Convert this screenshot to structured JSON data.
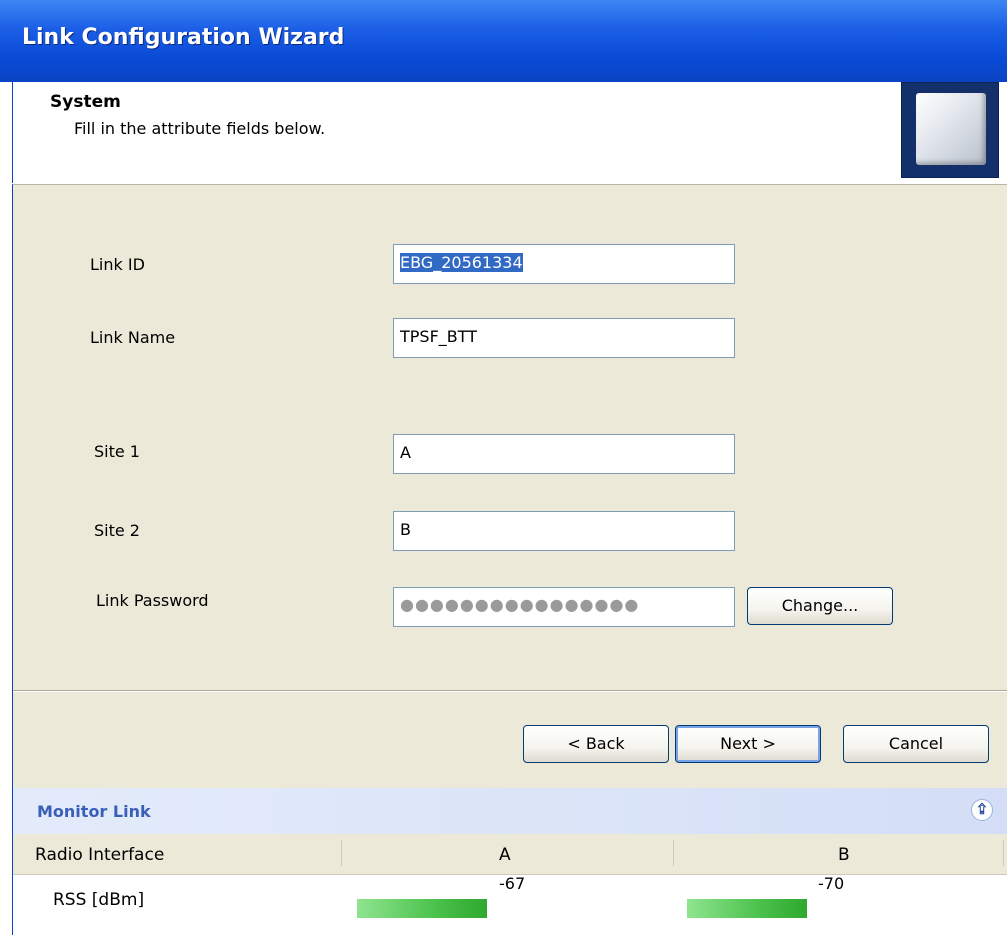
{
  "window": {
    "title": "Link Configuration Wizard"
  },
  "header": {
    "title": "System",
    "subtitle": "Fill in the attribute fields below."
  },
  "form": {
    "link_id": {
      "label": "Link ID",
      "value": "EBG_20561334"
    },
    "link_name": {
      "label": "Link Name",
      "value": "TPSF_BTT"
    },
    "site1": {
      "label": "Site 1",
      "value": "A"
    },
    "site2": {
      "label": "Site 2",
      "value": "B"
    },
    "link_password": {
      "label": "Link Password",
      "value": "●●●●●●●●●●●●●●●●",
      "change_label": "Change..."
    }
  },
  "buttons": {
    "back": "< Back",
    "next": "Next >",
    "cancel": "Cancel"
  },
  "monitor": {
    "title": "Monitor Link",
    "collapse_icon": "double-chevron-up-icon",
    "columns": [
      "Radio Interface",
      "A",
      "B"
    ],
    "rows": [
      {
        "label": "RSS [dBm]",
        "a": "-67",
        "b": "-70",
        "a_level": 0.41,
        "b_level": 0.38
      }
    ],
    "bar_color": "#4cc24c"
  }
}
